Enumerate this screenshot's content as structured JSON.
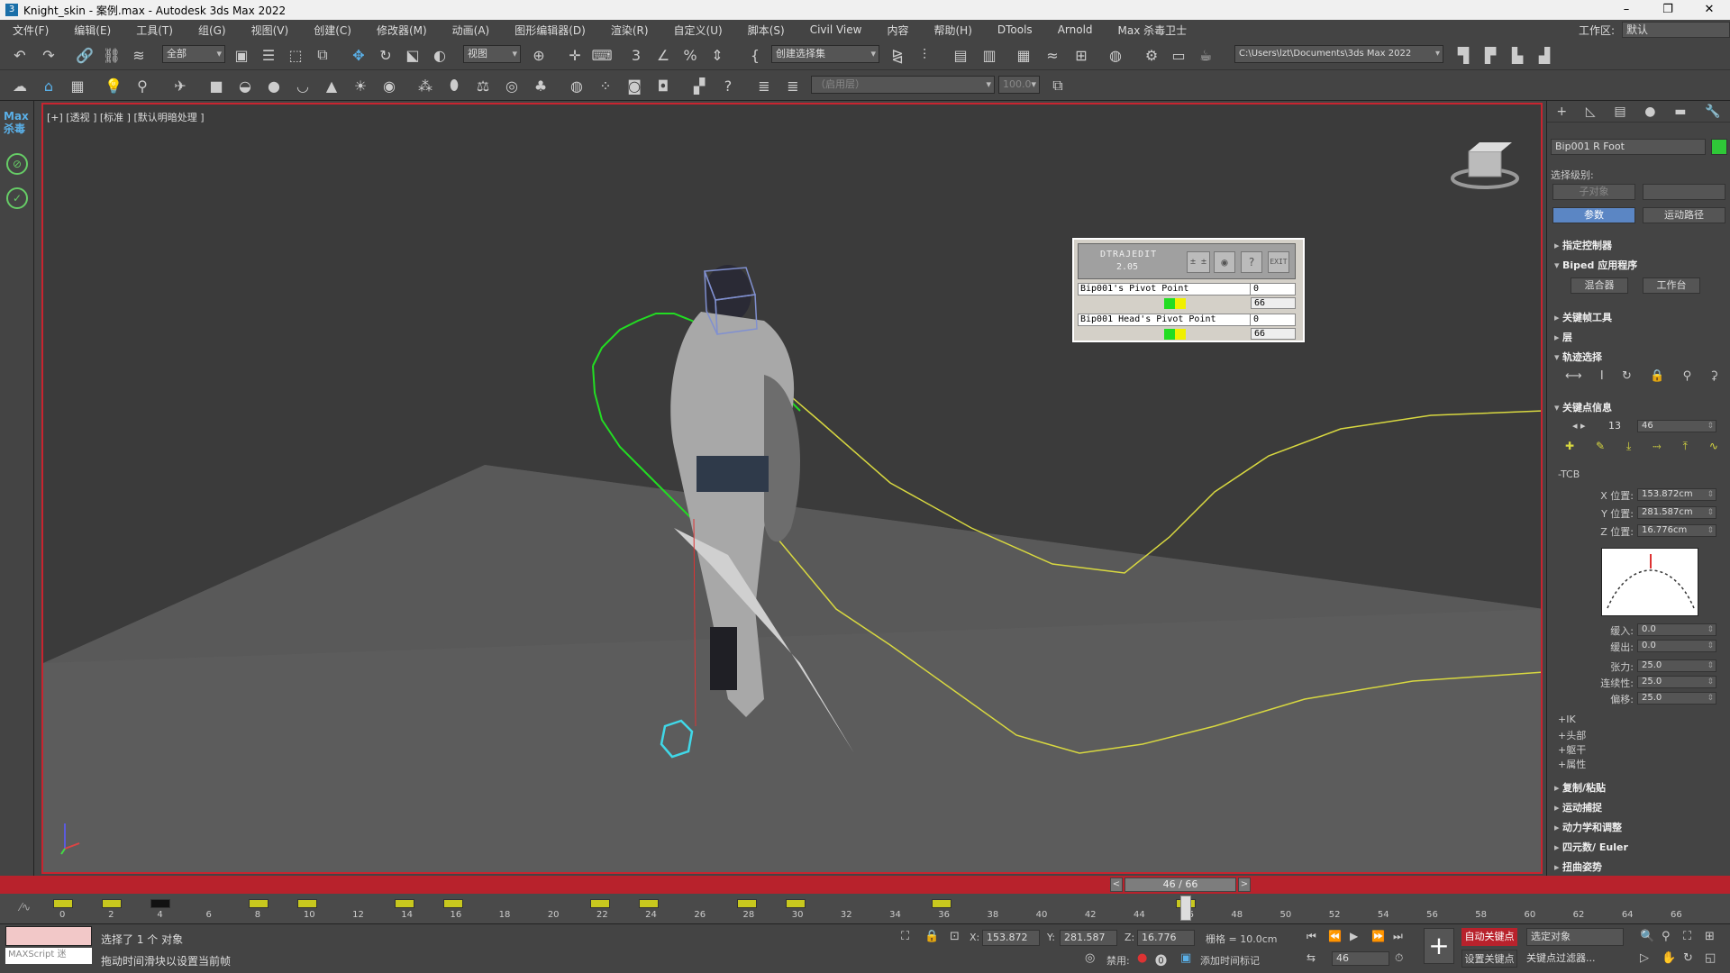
{
  "window": {
    "title": "Knight_skin - 案例.max - Autodesk 3ds Max 2022",
    "min": "–",
    "max": "❐",
    "close": "✕"
  },
  "menu": {
    "items": [
      "文件(F)",
      "编辑(E)",
      "工具(T)",
      "组(G)",
      "视图(V)",
      "创建(C)",
      "修改器(M)",
      "动画(A)",
      "图形编辑器(D)",
      "渲染(R)",
      "自定义(U)",
      "脚本(S)",
      "Civil View",
      "内容",
      "帮助(H)",
      "DTools",
      "Arnold",
      "Max 杀毒卫士"
    ],
    "workspace_label": "工作区:",
    "workspace_value": "默认"
  },
  "toolbar": {
    "filter_value": "全部",
    "ref_coord_value": "视图",
    "named_sel_value": "创建选择集",
    "project_path": "C:\\Users\\lzt\\Documents\\3ds Max 2022",
    "layer_value": "（启用层）",
    "spinner_value": "100.0"
  },
  "sidebar": {
    "logo_line1": "Max",
    "logo_line2": "杀毒"
  },
  "viewport": {
    "label": "[+] [透视 ] [标准 ] [默认明暗处理 ]"
  },
  "trajedit": {
    "title": "DTRAJEDIT",
    "version": "2.05",
    "rows": [
      {
        "name": "Bip001's Pivot Point",
        "value": "0",
        "frames": "66"
      },
      {
        "name": "Bip001 Head's Pivot Point",
        "value": "0",
        "frames": "66"
      }
    ],
    "exit_label": "EXIT"
  },
  "command_panel": {
    "object_name": "Bip001 R Foot",
    "object_color": "#2fc838",
    "selection_level_label": "选择级别:",
    "subobject_label": "子对象",
    "params_label": "参数",
    "motion_paths_label": "运动路径",
    "sections": {
      "assign_controller": "指定控制器",
      "biped_apps": "Biped 应用程序",
      "key_tools": "关键帧工具",
      "layers": "层",
      "track_selection": "轨迹选择",
      "key_info": "关键点信息",
      "copy_paste": "复制/粘贴",
      "motion_capture": "运动捕捉",
      "dynamics": "动力学和调整",
      "quaternion": "四元数/ Euler",
      "twist_poses": "扭曲姿势"
    },
    "mixer_label": "混合器",
    "workbench_label": "工作台",
    "key_number": "13",
    "key_time": "46",
    "tcb_label": "-TCB",
    "x_pos_label": "X 位置:",
    "x_pos": "153.872cm",
    "y_pos_label": "Y 位置:",
    "y_pos": "281.587cm",
    "z_pos_label": "Z 位置:",
    "z_pos": "16.776cm",
    "ease_in_label": "缓入:",
    "ease_in": "0.0",
    "ease_out_label": "缓出:",
    "ease_out": "0.0",
    "tension_label": "张力:",
    "tension": "25.0",
    "continuity_label": "连续性:",
    "continuity": "25.0",
    "bias_label": "偏移:",
    "bias": "25.0",
    "ik_label": "+IK",
    "head_label": "+头部",
    "body_label": "+躯干",
    "props_label": "+属性"
  },
  "timeline": {
    "frame_display": "46 / 66",
    "ticks": [
      "0",
      "2",
      "4",
      "6",
      "8",
      "10",
      "12",
      "14",
      "16",
      "18",
      "20",
      "22",
      "24",
      "26",
      "28",
      "30",
      "32",
      "34",
      "36",
      "38",
      "40",
      "42",
      "44",
      "46",
      "48",
      "50",
      "52",
      "54",
      "56",
      "58",
      "60",
      "62",
      "64",
      "66"
    ],
    "key_frames": [
      0,
      2,
      8,
      10,
      14,
      16,
      22,
      24,
      28,
      30,
      36,
      46
    ],
    "black_key_frames": [
      4
    ],
    "current_frame": 46
  },
  "status": {
    "maxscript": "MAXScript 迷",
    "selected": "选择了 1 个 对象",
    "prompt": "拖动时间滑块以设置当前帧",
    "x_label": "X:",
    "x_val": "153.872",
    "y_label": "Y:",
    "y_val": "281.587",
    "z_label": "Z:",
    "z_val": "16.776",
    "grid": "栅格 = 10.0cm",
    "disabled_label": "禁用:",
    "add_time_tag": "添加时间标记",
    "auto_key": "自动关键点",
    "set_key": "设置关键点",
    "selected_object": "选定对象",
    "key_filters": "关键点过滤器...",
    "current_frame": "46"
  },
  "colors": {
    "accent_red": "#b8222c",
    "trajectory_yellow": "#d8d840",
    "key_green": "#22dd22",
    "selected_cyan": "#40d8e8"
  }
}
